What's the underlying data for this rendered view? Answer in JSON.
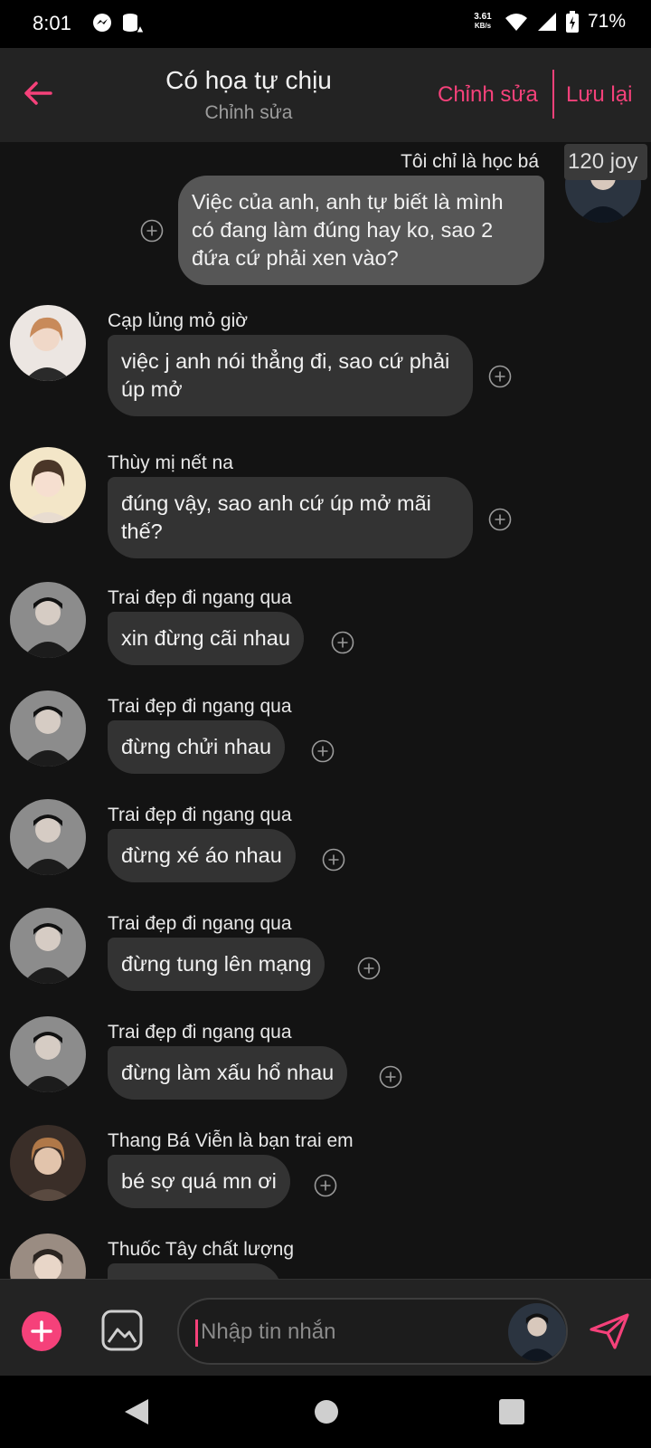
{
  "status": {
    "time": "8:01",
    "net_speed_value": "3.61",
    "net_speed_unit": "KB/s",
    "battery": "71%"
  },
  "header": {
    "title": "Có họa tự chịu",
    "subtitle": "Chỉnh sửa",
    "edit_label": "Chỉnh sửa",
    "save_label": "Lưu lại"
  },
  "own_message": {
    "sender": "Tôi chỉ là học bá",
    "tag": "120 joy",
    "text": "Việc của anh, anh tự biết là mình có đang làm đúng hay ko, sao 2 đứa cứ phải xen vào?"
  },
  "messages": [
    {
      "sender": "Cạp lủng mỏ giờ",
      "text": "việc j anh nói thẳng đi, sao cứ phải úp mở"
    },
    {
      "sender": "Thùy mị nết na",
      "text": "đúng vậy, sao anh cứ úp mở mãi thế?"
    },
    {
      "sender": "Trai đẹp đi ngang qua",
      "text": "xin đừng cãi nhau"
    },
    {
      "sender": "Trai đẹp đi ngang qua",
      "text": "đừng chửi nhau"
    },
    {
      "sender": "Trai đẹp đi ngang qua",
      "text": "đừng xé áo nhau"
    },
    {
      "sender": "Trai đẹp đi ngang qua",
      "text": "đừng tung lên mạng"
    },
    {
      "sender": "Trai đẹp đi ngang qua",
      "text": "đừng làm xấu hổ nhau"
    },
    {
      "sender": "Thang Bá Viễn là bạn trai em",
      "text": "bé sợ quá mn ơi"
    },
    {
      "sender": "Thuốc Tây chất lượng",
      "text": ""
    }
  ],
  "input": {
    "placeholder": "Nhập tin nhắn"
  },
  "colors": {
    "accent": "#f5417a",
    "background": "#131313",
    "bubble_in": "#333333",
    "bubble_out": "#565656"
  }
}
